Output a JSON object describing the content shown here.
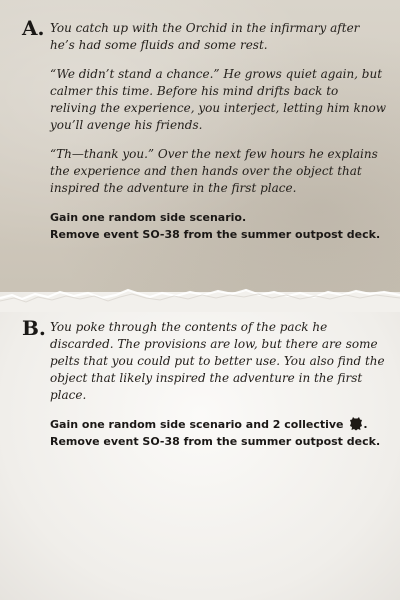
{
  "colors": {
    "top_paper": "#d4cec3",
    "bottom_paper": "#f2f0ec",
    "ink": "#1e1a16"
  },
  "section_a": {
    "letter": "A.",
    "paragraphs": [
      "You catch up with the Orchid in the infirmary after he’s had some fluids and some rest.",
      "“We didn’t stand a chance.” He grows quiet again, but calmer this time. Before his mind drifts back to reliving the experience, you interject, letting him know you’ll avenge his friends.",
      "“Th—thank you.” Over the next few hours he explains the experience and then hands over the object that inspired the adventure in the first place."
    ],
    "effects": [
      "Gain one random side scenario.",
      "Remove event SO-38 from the summer outpost deck."
    ]
  },
  "section_b": {
    "letter": "B.",
    "paragraphs": [
      "You poke through the contents of the pack he discarded. The provisions are low, but there are some pelts that you could put to better use. You also find the object that likely inspired the adventure in the first place."
    ],
    "effect_1_prefix": "Gain one random side scenario and 2 collective",
    "effect_1_icon": "pelt-icon",
    "effect_1_suffix": ".",
    "effect_2": "Remove event SO-38 from the summer outpost deck."
  }
}
